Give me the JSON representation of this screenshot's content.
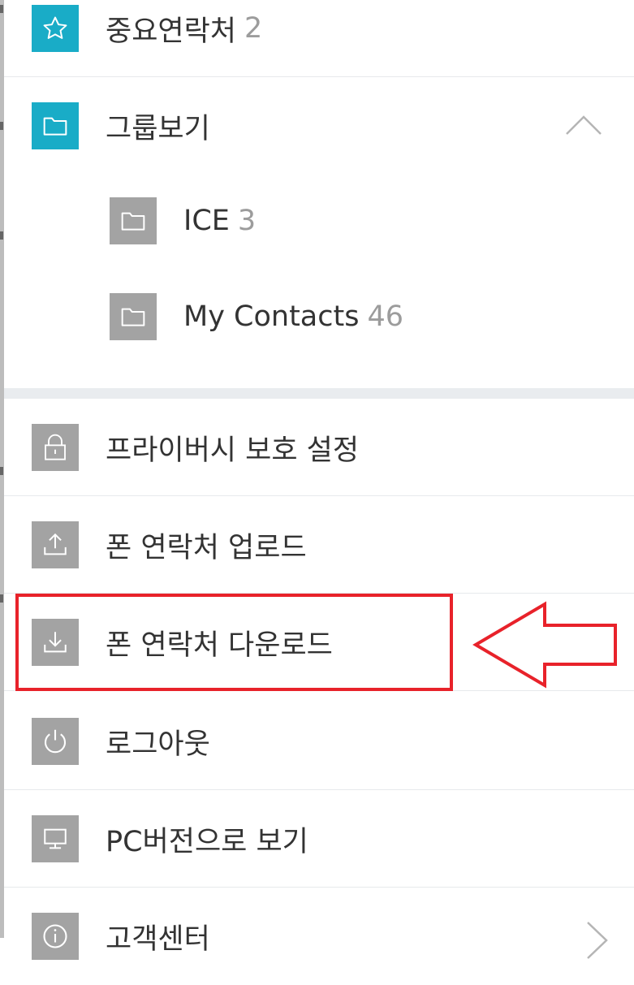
{
  "menu": {
    "favorites": {
      "label": "중요연락처",
      "count": "2"
    },
    "groups": {
      "label": "그룹보기",
      "items": [
        {
          "label": "ICE",
          "count": "3"
        },
        {
          "label": "My Contacts",
          "count": "46"
        }
      ]
    },
    "privacy": {
      "label": "프라이버시 보호 설정"
    },
    "upload": {
      "label": "폰 연락처 업로드"
    },
    "download": {
      "label": "폰 연락처 다운로드"
    },
    "logout": {
      "label": "로그아웃"
    },
    "pc_version": {
      "label": "PC버전으로 보기"
    },
    "support": {
      "label": "고객센터"
    }
  },
  "colors": {
    "accent": "#19acc7",
    "icon_grey": "#a3a3a3",
    "annotation_red": "#e8222a"
  },
  "icons": {
    "favorites": "star-icon",
    "groups": "folder-icon",
    "privacy": "lock-icon",
    "upload": "upload-icon",
    "download": "download-icon",
    "logout": "power-icon",
    "pc_version": "monitor-icon",
    "support": "info-icon"
  }
}
